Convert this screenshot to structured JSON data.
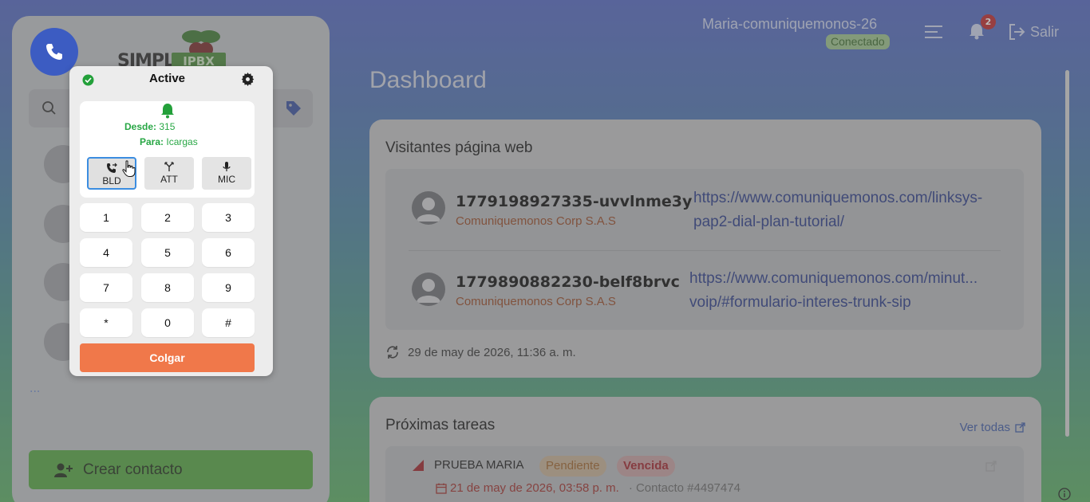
{
  "brand": {
    "logo_text": "SIMPLE",
    "logo_badge": "IPBX"
  },
  "header": {
    "user_name": "Maria-comuniquemonos-26",
    "status": "Conectado",
    "notification_count": "2",
    "logout_label": "Salir"
  },
  "page": {
    "title": "Dashboard"
  },
  "visitors": {
    "title": "Visitantes página web",
    "items": [
      {
        "id": "1779198927335-uvvlnme3y",
        "company": "Comuniquemonos Corp S.A.S",
        "url_line1": "https://www.comuniquemonos.com/linksys-",
        "url_line2": "pap2-dial-plan-tutorial/"
      },
      {
        "id": "1779890882230-belf8brvc",
        "company": "Comuniquemonos Corp S.A.S",
        "url_line1": "https://www.comuniquemonos.com/minut...",
        "url_line2": "voip/#formulario-interes-trunk-sip"
      }
    ],
    "updated": "29 de may de 2026, 11:36 a. m."
  },
  "tasks": {
    "title": "Próximas tareas",
    "see_all": "Ver todas",
    "items": [
      {
        "name": "PRUEBA MARIA",
        "status": "Pendiente",
        "due_status": "Vencida",
        "date": "21 de may de 2026, 03:58 p. m.",
        "contact": "· Contacto #4497474"
      }
    ]
  },
  "sidebar": {
    "more": "...",
    "create_contact": "Crear contacto"
  },
  "softphone": {
    "status": "Active",
    "from_label": "Desde:",
    "from_value": "315",
    "to_label": "Para:",
    "to_value": "Icargas",
    "buttons": [
      "BLD",
      "ATT",
      "MIC"
    ],
    "keys": [
      "1",
      "2",
      "3",
      "4",
      "5",
      "6",
      "7",
      "8",
      "9",
      "*",
      "0",
      "#"
    ],
    "hangup": "Colgar"
  },
  "colors": {
    "accent": "#3c5cc2",
    "success": "#28a745",
    "hangup": "#f0784a",
    "create": "#55a843"
  }
}
